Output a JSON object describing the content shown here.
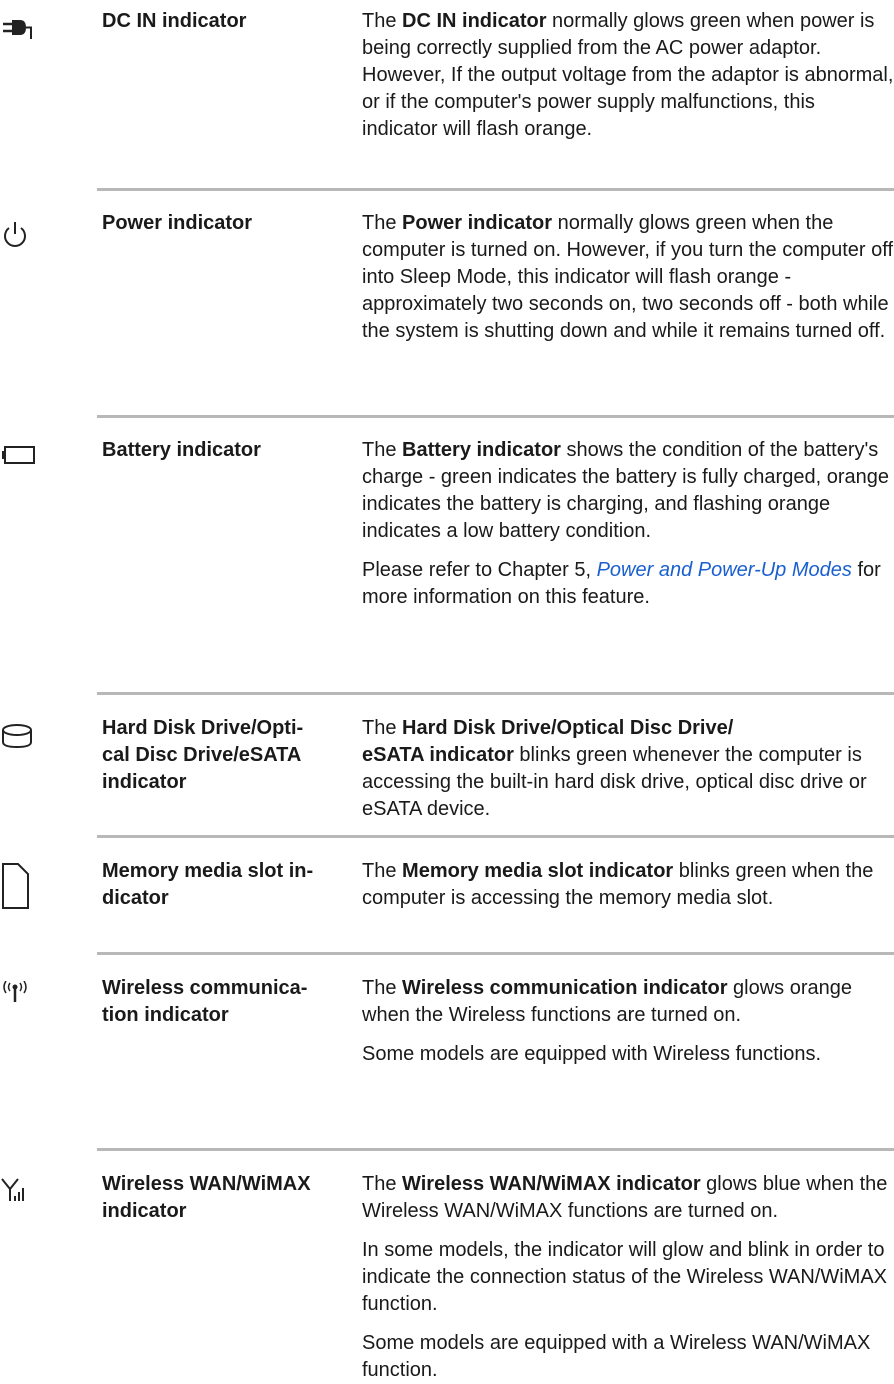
{
  "rows": [
    {
      "icon": "dc-in-plug-icon",
      "term": "DC IN indicator",
      "paragraphs": [
        {
          "pre": "The ",
          "bold": "DC IN indicator",
          "post": " normally glows green when power is being correctly supplied from the AC power adaptor. However, If the output voltage from the adaptor is abnormal, or if the computer's power supply malfunctions, this indicator will flash orange."
        }
      ]
    },
    {
      "icon": "power-icon",
      "term": "Power indicator",
      "paragraphs": [
        {
          "pre": "The ",
          "bold": "Power indicator",
          "post": " normally glows green when the computer is turned on. However, if you turn the computer off into Sleep Mode, this indicator will flash orange - approximately two seconds on, two seconds off - both while the system is shutting down and while it remains turned off."
        }
      ]
    },
    {
      "icon": "battery-icon",
      "term": "Battery indicator",
      "paragraphs": [
        {
          "pre": "The ",
          "bold": "Battery indicator",
          "post": " shows the condition of the battery's charge - green indicates the battery is fully charged, orange indicates the battery is charging, and flashing orange indicates a low battery condition."
        },
        {
          "pre": "Please refer to Chapter 5, ",
          "link": "Power and Power-Up Modes",
          "post": " for more information on this feature."
        }
      ]
    },
    {
      "icon": "hard-disk-icon",
      "term": "Hard Disk Drive/Optical Disc Drive/eSATA indicator",
      "paragraphs": [
        {
          "pre": "The ",
          "bold": "Hard Disk Drive/Optical Disc Drive/ eSATA indicator",
          "post": " blinks green whenever the computer is accessing the built-in hard disk drive, optical disc drive or eSATA device."
        }
      ]
    },
    {
      "icon": "memory-card-icon",
      "term": "Memory media slot indicator",
      "paragraphs": [
        {
          "pre": "The ",
          "bold": "Memory media slot indicator",
          "post": " blinks green when the computer is accessing the memory media slot."
        }
      ]
    },
    {
      "icon": "wireless-icon",
      "term": "Wireless communication indicator",
      "paragraphs": [
        {
          "pre": "The ",
          "bold": "Wireless communication indicator",
          "post": " glows orange when the Wireless functions are turned on."
        },
        {
          "pre": "Some models are equipped with Wireless functions."
        }
      ]
    },
    {
      "icon": "wireless-wan-icon",
      "term": "Wireless WAN/WiMAX indicator",
      "paragraphs": [
        {
          "pre": "The ",
          "bold": "Wireless WAN/WiMAX indicator",
          "post": " glows blue when the Wireless WAN/WiMAX functions are turned on."
        },
        {
          "pre": "In some models, the indicator will glow and blink in order to indicate the connection status of the Wireless WAN/WiMAX function."
        },
        {
          "pre": "Some models are equipped with a Wireless WAN/WiMAX function."
        }
      ]
    }
  ]
}
